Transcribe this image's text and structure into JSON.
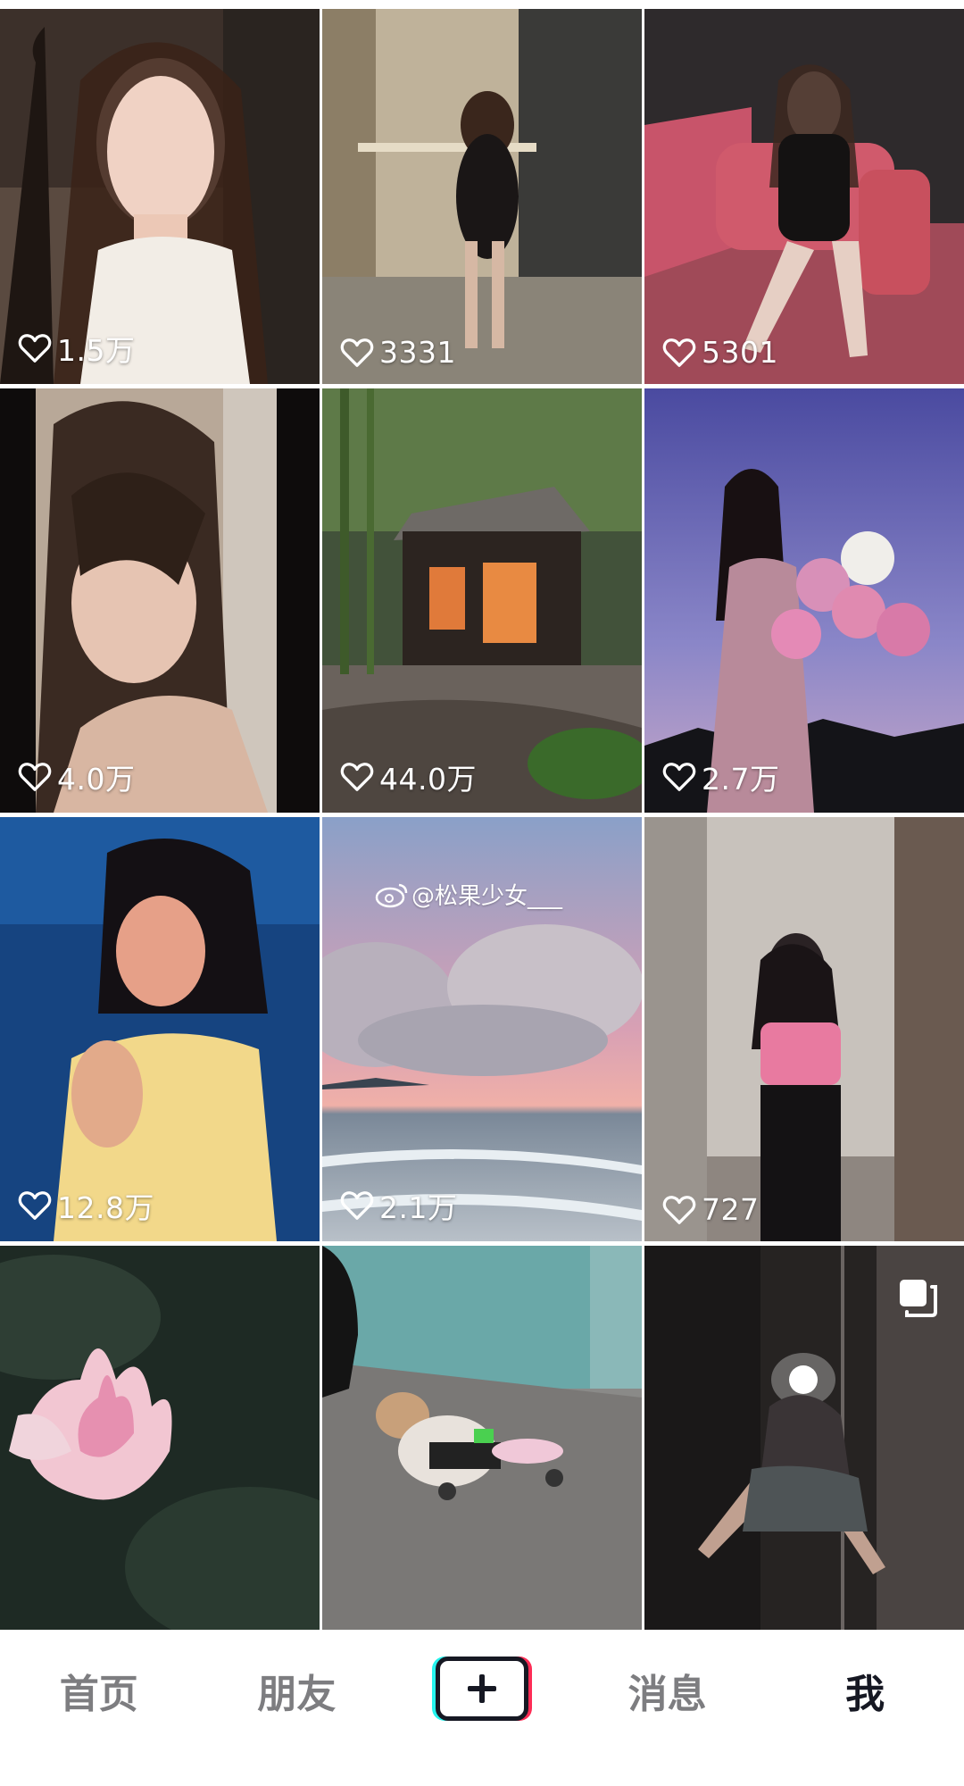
{
  "feed": {
    "posts": [
      {
        "likes": "1.5万"
      },
      {
        "likes": "3331"
      },
      {
        "likes": "5301"
      },
      {
        "likes": "4.0万"
      },
      {
        "likes": "44.0万"
      },
      {
        "likes": "2.7万"
      },
      {
        "likes": "12.8万"
      },
      {
        "likes": "2.1万",
        "watermark": "@松果少女___"
      },
      {
        "likes": "727"
      },
      {
        "likes": ""
      },
      {
        "likes": ""
      },
      {
        "likes": ""
      }
    ]
  },
  "nav": {
    "home": "首页",
    "friends": "朋友",
    "messages": "消息",
    "me": "我"
  },
  "colors": {
    "active_text": "#161823",
    "inactive_text": "#7d7d80",
    "accent_cyan": "#25f4ee",
    "accent_red": "#fe2c55"
  }
}
